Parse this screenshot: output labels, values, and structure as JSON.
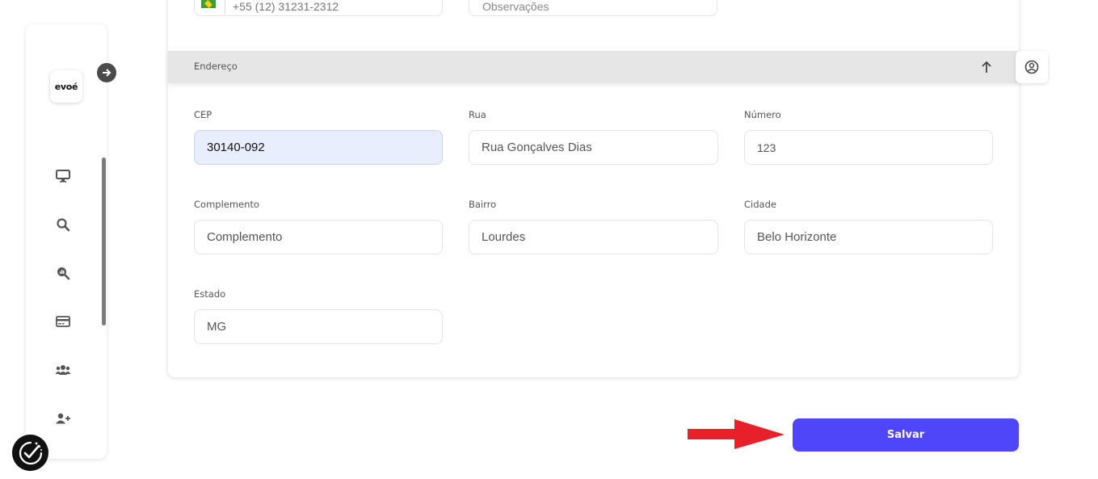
{
  "sidebar": {
    "logo_text": "evoé",
    "items": [
      {
        "icon": "monitor-icon"
      },
      {
        "icon": "search-icon"
      },
      {
        "icon": "search-chart-icon"
      },
      {
        "icon": "credit-card-icon"
      },
      {
        "icon": "users-icon"
      },
      {
        "icon": "add-user-icon"
      }
    ]
  },
  "top_fields": {
    "phone_value": "+55 (12) 31231-2312",
    "observacoes_placeholder": "Observações"
  },
  "address_section": {
    "title": "Endereço",
    "fields": {
      "cep": {
        "label": "CEP",
        "value": "30140-092"
      },
      "rua": {
        "label": "Rua",
        "value": "Rua Gonçalves Dias"
      },
      "numero": {
        "label": "Número",
        "value": "123"
      },
      "complemento": {
        "label": "Complemento",
        "placeholder": "Complemento"
      },
      "bairro": {
        "label": "Bairro",
        "value": "Lourdes"
      },
      "cidade": {
        "label": "Cidade",
        "value": "Belo Horizonte"
      },
      "estado": {
        "label": "Estado",
        "value": "MG"
      }
    }
  },
  "actions": {
    "save_label": "Salvar"
  },
  "colors": {
    "primary": "#4f46fa",
    "arrow": "#e8202a",
    "active_input_bg": "#e8eefc"
  }
}
